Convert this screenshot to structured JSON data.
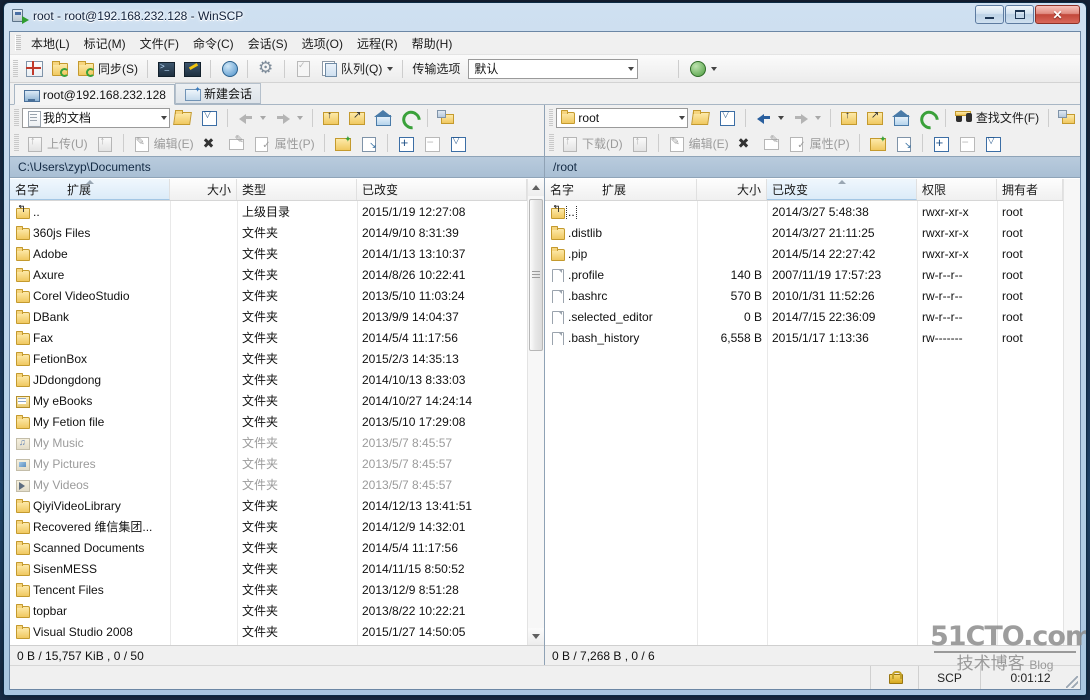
{
  "window": {
    "title": "root - root@192.168.232.128 - WinSCP",
    "icon": "winscp-icon",
    "minimize": "–",
    "maximize": "□",
    "close": "✕"
  },
  "menubar": [
    {
      "label": "本地(L)"
    },
    {
      "label": "标记(M)"
    },
    {
      "label": "文件(F)"
    },
    {
      "label": "命令(C)"
    },
    {
      "label": "会话(S)"
    },
    {
      "label": "选项(O)"
    },
    {
      "label": "远程(R)"
    },
    {
      "label": "帮助(H)"
    }
  ],
  "toolbar": {
    "sync_label": "同步(S)",
    "queue_label": "队列(Q)",
    "transfer_label": "传输选项",
    "transfer_value": "默认"
  },
  "tabs": [
    {
      "label": "root@192.168.232.128",
      "active": true
    },
    {
      "label": "新建会话",
      "active": false
    }
  ],
  "left_panel": {
    "drive": "我的文档",
    "path": "C:\\Users\\zyp\\Documents",
    "upload_label": "上传(U)",
    "edit_label": "编辑(E)",
    "properties_label": "属性(P)",
    "columns": [
      "名字",
      "扩展",
      "大小",
      "类型",
      "已改变"
    ],
    "rows": [
      {
        "name": "..",
        "icon": "up-folder-icon",
        "ext": "",
        "size": "",
        "type": "上级目录",
        "modified": "2015/1/19  12:27:08",
        "dim": false
      },
      {
        "name": "360js Files",
        "icon": "folder-icon",
        "ext": "",
        "size": "",
        "type": "文件夹",
        "modified": "2014/9/10  8:31:39",
        "dim": false
      },
      {
        "name": "Adobe",
        "icon": "folder-icon",
        "ext": "",
        "size": "",
        "type": "文件夹",
        "modified": "2014/1/13  13:10:37",
        "dim": false
      },
      {
        "name": "Axure",
        "icon": "folder-icon",
        "ext": "",
        "size": "",
        "type": "文件夹",
        "modified": "2014/8/26  10:22:41",
        "dim": false
      },
      {
        "name": "Corel VideoStudio",
        "icon": "folder-icon",
        "ext": "",
        "size": "",
        "type": "文件夹",
        "modified": "2013/5/10  11:03:24",
        "dim": false
      },
      {
        "name": "DBank",
        "icon": "folder-icon",
        "ext": "",
        "size": "",
        "type": "文件夹",
        "modified": "2013/9/9  14:04:37",
        "dim": false
      },
      {
        "name": "Fax",
        "icon": "folder-icon",
        "ext": "",
        "size": "",
        "type": "文件夹",
        "modified": "2014/5/4  11:17:56",
        "dim": false
      },
      {
        "name": "FetionBox",
        "icon": "folder-icon",
        "ext": "",
        "size": "",
        "type": "文件夹",
        "modified": "2015/2/3  14:35:13",
        "dim": false
      },
      {
        "name": "JDdongdong",
        "icon": "folder-icon",
        "ext": "",
        "size": "",
        "type": "文件夹",
        "modified": "2014/10/13  8:33:03",
        "dim": false
      },
      {
        "name": "My eBooks",
        "icon": "ebooks-folder-icon",
        "ext": "",
        "size": "",
        "type": "文件夹",
        "modified": "2014/10/27  14:24:14",
        "dim": false
      },
      {
        "name": "My Fetion file",
        "icon": "folder-icon",
        "ext": "",
        "size": "",
        "type": "文件夹",
        "modified": "2013/5/10  17:29:08",
        "dim": false
      },
      {
        "name": "My Music",
        "icon": "music-folder-icon",
        "ext": "",
        "size": "",
        "type": "文件夹",
        "modified": "2013/5/7  8:45:57",
        "dim": true
      },
      {
        "name": "My Pictures",
        "icon": "pictures-folder-icon",
        "ext": "",
        "size": "",
        "type": "文件夹",
        "modified": "2013/5/7  8:45:57",
        "dim": true
      },
      {
        "name": "My Videos",
        "icon": "videos-folder-icon",
        "ext": "",
        "size": "",
        "type": "文件夹",
        "modified": "2013/5/7  8:45:57",
        "dim": true
      },
      {
        "name": "QiyiVideoLibrary",
        "icon": "folder-icon",
        "ext": "",
        "size": "",
        "type": "文件夹",
        "modified": "2014/12/13  13:41:51",
        "dim": false
      },
      {
        "name": "Recovered 维信集团...",
        "icon": "folder-icon",
        "ext": "",
        "size": "",
        "type": "文件夹",
        "modified": "2014/12/9  14:32:01",
        "dim": false
      },
      {
        "name": "Scanned Documents",
        "icon": "folder-icon",
        "ext": "",
        "size": "",
        "type": "文件夹",
        "modified": "2014/5/4  11:17:56",
        "dim": false
      },
      {
        "name": "SisenMESS",
        "icon": "folder-icon",
        "ext": "",
        "size": "",
        "type": "文件夹",
        "modified": "2014/11/15  8:50:52",
        "dim": false
      },
      {
        "name": "Tencent Files",
        "icon": "folder-icon",
        "ext": "",
        "size": "",
        "type": "文件夹",
        "modified": "2013/12/9  8:51:28",
        "dim": false
      },
      {
        "name": "topbar",
        "icon": "folder-icon",
        "ext": "",
        "size": "",
        "type": "文件夹",
        "modified": "2013/8/22  10:22:21",
        "dim": false
      },
      {
        "name": "Visual Studio 2008",
        "icon": "folder-icon",
        "ext": "",
        "size": "",
        "type": "文件夹",
        "modified": "2015/1/27  14:50:05",
        "dim": false
      }
    ],
    "status": "0 B / 15,757 KiB ,  0 / 50"
  },
  "right_panel": {
    "drive": "root",
    "path": "/root",
    "download_label": "下载(D)",
    "edit_label": "编辑(E)",
    "properties_label": "属性(P)",
    "find_label": "查找文件(F)",
    "columns": [
      "名字",
      "扩展",
      "大小",
      "已改变",
      "权限",
      "拥有者"
    ],
    "rows": [
      {
        "name": "..",
        "icon": "up-folder-icon",
        "ext": "",
        "size": "",
        "modified": "2014/3/27 5:48:38",
        "rights": "rwxr-xr-x",
        "owner": "root",
        "focused": true
      },
      {
        "name": ".distlib",
        "icon": "folder-icon",
        "ext": "",
        "size": "",
        "modified": "2014/3/27 21:11:25",
        "rights": "rwxr-xr-x",
        "owner": "root",
        "focused": false
      },
      {
        "name": ".pip",
        "icon": "folder-icon",
        "ext": "",
        "size": "",
        "modified": "2014/5/14 22:27:42",
        "rights": "rwxr-xr-x",
        "owner": "root",
        "focused": false
      },
      {
        "name": ".profile",
        "icon": "file-icon",
        "ext": "",
        "size": "140 B",
        "modified": "2007/11/19 17:57:23",
        "rights": "rw-r--r--",
        "owner": "root",
        "focused": false
      },
      {
        "name": ".bashrc",
        "icon": "file-icon",
        "ext": "",
        "size": "570 B",
        "modified": "2010/1/31 11:52:26",
        "rights": "rw-r--r--",
        "owner": "root",
        "focused": false
      },
      {
        "name": ".selected_editor",
        "icon": "file-icon",
        "ext": "",
        "size": "0 B",
        "modified": "2014/7/15 22:36:09",
        "rights": "rw-r--r--",
        "owner": "root",
        "focused": false
      },
      {
        "name": ".bash_history",
        "icon": "file-icon",
        "ext": "",
        "size": "6,558 B",
        "modified": "2015/1/17 1:13:36",
        "rights": "rw-------",
        "owner": "root",
        "focused": false
      }
    ],
    "status": "0 B / 7,268 B ,  0 / 6"
  },
  "bottombar": {
    "lock": "lock-icon",
    "protocol": "SCP",
    "elapsed": "0:01:12"
  },
  "watermark": {
    "line1": "51CTO.com",
    "line2": "技术博客",
    "line3": "Blog"
  }
}
